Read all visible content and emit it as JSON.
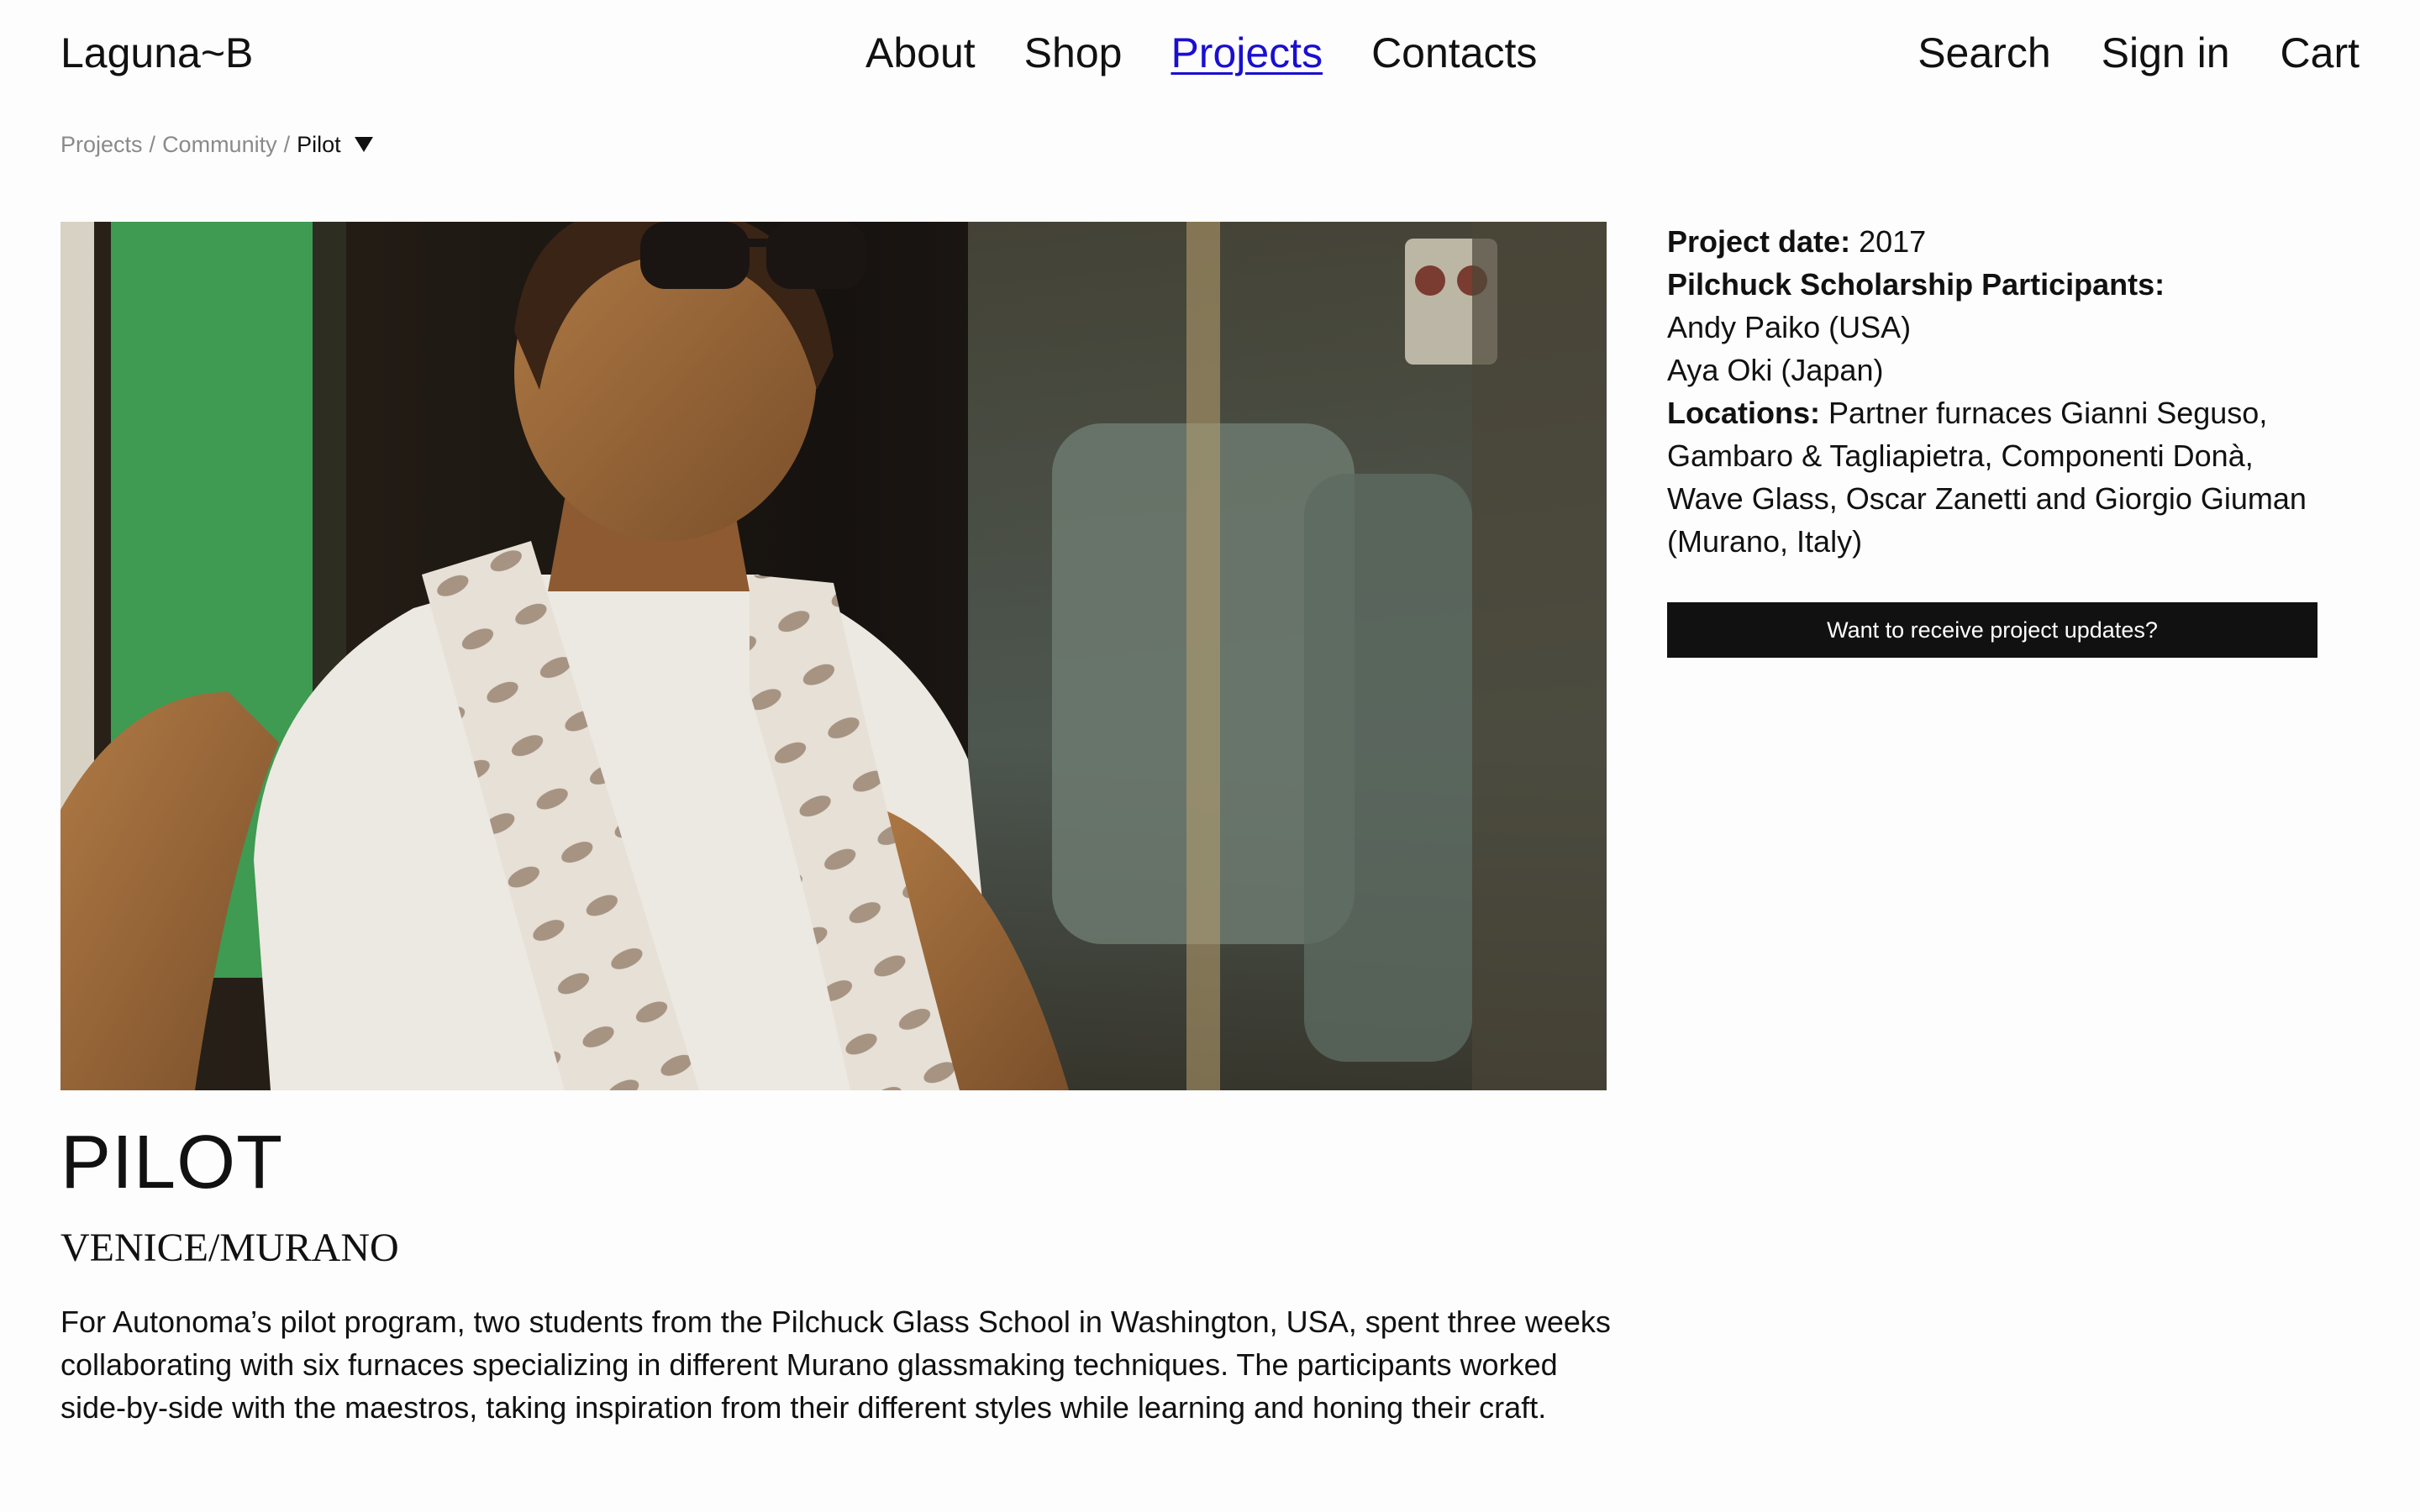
{
  "header": {
    "logo": "Laguna~B",
    "nav": [
      {
        "label": "About",
        "active": false
      },
      {
        "label": "Shop",
        "active": false
      },
      {
        "label": "Projects",
        "active": true
      },
      {
        "label": "Contacts",
        "active": false
      }
    ],
    "right": [
      "Search",
      "Sign in",
      "Cart"
    ]
  },
  "breadcrumb": {
    "items": [
      "Projects",
      "Community"
    ],
    "separator": "/",
    "current": "Pilot"
  },
  "hero": {
    "icon": "photo-glassmaker-with-towel"
  },
  "project": {
    "title": "PILOT",
    "subtitle": "VENICE/MURANO",
    "description": "For Autonoma’s pilot program, two students from the Pilchuck Glass School in Washington, USA, spent three weeks collaborating with six furnaces specializing in different Murano glassmaking techniques. The participants worked side-by-side with the maestros, taking inspiration from their different styles while learning and honing their craft."
  },
  "meta": {
    "date_label": "Project date:",
    "date_value": " 2017",
    "participants_label": "Pilchuck Scholarship Participants:",
    "participants": [
      "Andy Paiko (USA)",
      "Aya Oki (Japan)"
    ],
    "locations_label": "Locations:",
    "locations_value": " Partner furnaces Gianni Seguso, Gambaro & Tagliapietra, Componenti Donà, Wave Glass, Oscar Zanetti and Giorgio Giuman (Murano, Italy)"
  },
  "cta": {
    "label": "Want to receive project updates?"
  },
  "colors": {
    "background": "#fdfdfd",
    "text": "#111111",
    "link_active": "#1a0fd0",
    "breadcrumb_muted": "#8a8a8a",
    "cta_bg": "#111111",
    "cta_text": "#ffffff"
  }
}
